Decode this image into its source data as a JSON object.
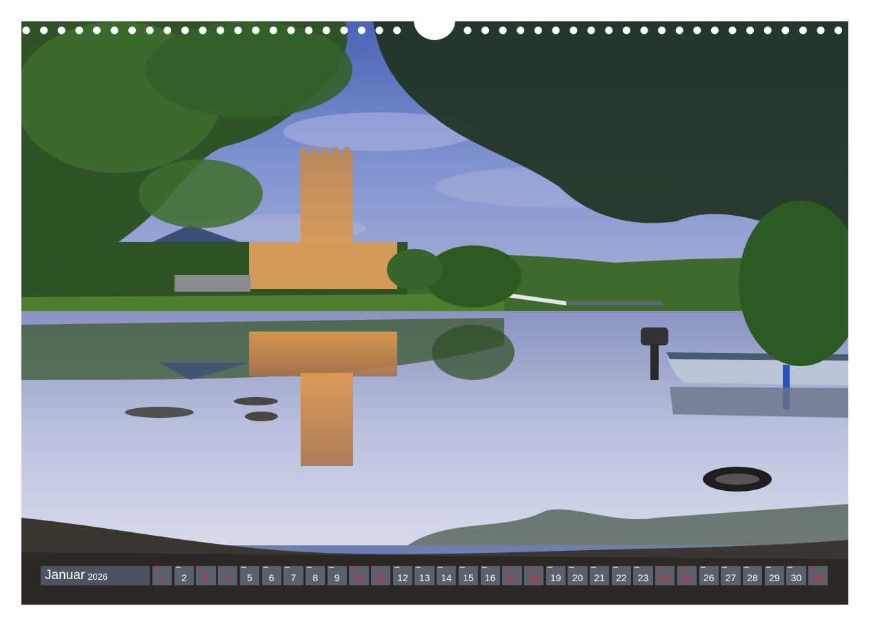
{
  "calendar": {
    "month": "Januar",
    "year": "2026",
    "days": [
      {
        "num": "1",
        "holiday": true
      },
      {
        "num": "2",
        "holiday": false
      },
      {
        "num": "3",
        "holiday": true
      },
      {
        "num": "4",
        "holiday": true
      },
      {
        "num": "5",
        "holiday": false
      },
      {
        "num": "6",
        "holiday": false
      },
      {
        "num": "7",
        "holiday": false
      },
      {
        "num": "8",
        "holiday": false
      },
      {
        "num": "9",
        "holiday": false
      },
      {
        "num": "10",
        "holiday": true
      },
      {
        "num": "11",
        "holiday": true
      },
      {
        "num": "12",
        "holiday": false
      },
      {
        "num": "13",
        "holiday": false
      },
      {
        "num": "14",
        "holiday": false
      },
      {
        "num": "15",
        "holiday": false
      },
      {
        "num": "16",
        "holiday": false
      },
      {
        "num": "17",
        "holiday": true
      },
      {
        "num": "18",
        "holiday": true
      },
      {
        "num": "19",
        "holiday": false
      },
      {
        "num": "20",
        "holiday": false
      },
      {
        "num": "21",
        "holiday": false
      },
      {
        "num": "22",
        "holiday": false
      },
      {
        "num": "23",
        "holiday": false
      },
      {
        "num": "24",
        "holiday": true
      },
      {
        "num": "25",
        "holiday": true
      },
      {
        "num": "26",
        "holiday": false
      },
      {
        "num": "27",
        "holiday": false
      },
      {
        "num": "28",
        "holiday": false
      },
      {
        "num": "29",
        "holiday": false
      },
      {
        "num": "30",
        "holiday": false
      },
      {
        "num": "31",
        "holiday": true
      }
    ]
  },
  "colors": {
    "month_box": "#4d5360",
    "day_box": "#5a606c",
    "day_text": "#ffffff",
    "holiday_text": "#e0283c"
  }
}
